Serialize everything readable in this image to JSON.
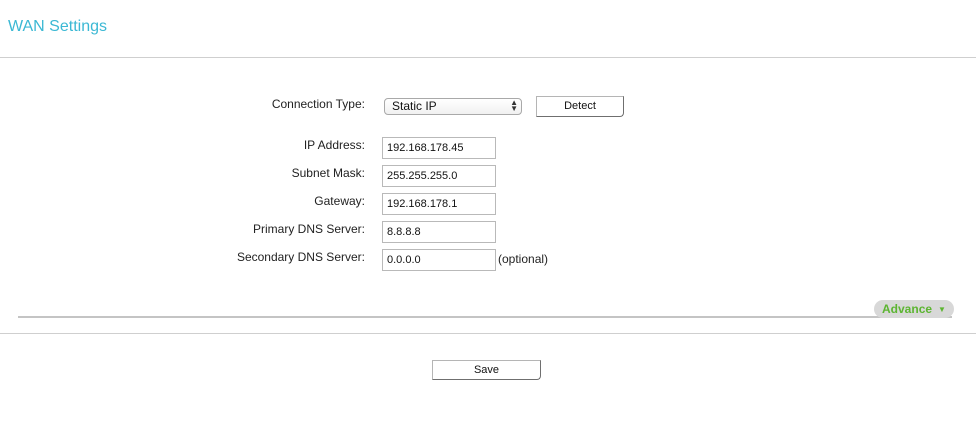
{
  "header": {
    "title": "WAN Settings"
  },
  "form": {
    "connection_type": {
      "label": "Connection Type:",
      "value": "Static IP",
      "detect_label": "Detect"
    },
    "ip_address": {
      "label": "IP Address:",
      "value": "192.168.178.45"
    },
    "subnet_mask": {
      "label": "Subnet Mask:",
      "value": "255.255.255.0"
    },
    "gateway": {
      "label": "Gateway:",
      "value": "192.168.178.1"
    },
    "primary_dns": {
      "label": "Primary DNS Server:",
      "value": "8.8.8.8"
    },
    "secondary_dns": {
      "label": "Secondary DNS Server:",
      "value": "0.0.0.0",
      "hint": "(optional)"
    }
  },
  "advance": {
    "label": "Advance",
    "icon": "caret-down-icon",
    "color": "#5cb531"
  },
  "footer": {
    "save_label": "Save"
  },
  "colors": {
    "title": "#3bb8d4"
  }
}
